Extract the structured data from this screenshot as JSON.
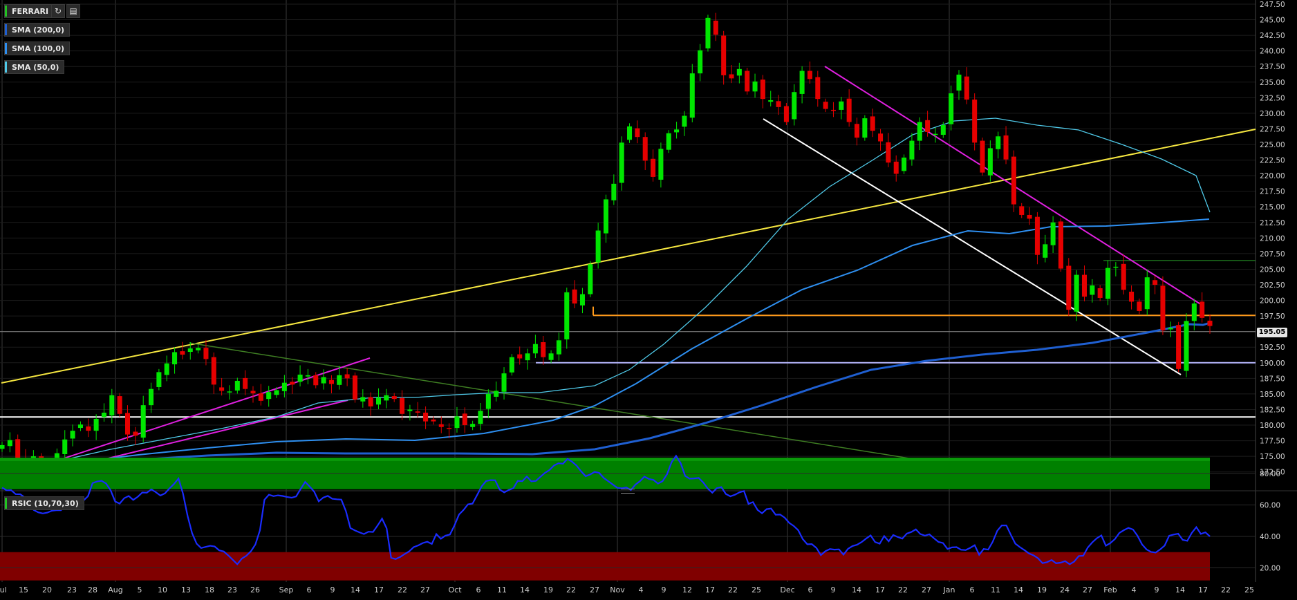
{
  "header": {
    "symbol": "FERRARI",
    "refresh_icon": "refresh-icon",
    "settings_icon": "chart-settings-icon",
    "indicators": [
      {
        "label": "SMA (200,0)",
        "color": "#1f5fd1"
      },
      {
        "label": "SMA (100,0)",
        "color": "#2e8ff0"
      },
      {
        "label": "SMA (50,0)",
        "color": "#4fc9e8"
      }
    ]
  },
  "price_badge": "195.05",
  "rsi_label": "RSIC (10,70,30)",
  "colors": {
    "up": "#00e600",
    "down": "#e60000",
    "sma200": "#1f5fd1",
    "sma100": "#2e8ff0",
    "sma50": "#4fc9e8",
    "rsi": "#1a2cff",
    "overbought": "#008000",
    "oversold": "#800000",
    "yellow": "#f5e640",
    "magenta": "#e020e0",
    "orange": "#ff9a1a",
    "lavender": "#b8b8ff"
  },
  "chart_data": [
    {
      "type": "candlestick",
      "title": "",
      "x_tick_labels": [
        "Jul",
        "15",
        "20",
        "23",
        "28",
        "Aug",
        "5",
        "10",
        "13",
        "18",
        "23",
        "26",
        "Sep",
        "6",
        "9",
        "14",
        "17",
        "22",
        "27",
        "Oct",
        "6",
        "11",
        "14",
        "19",
        "22",
        "27",
        "Nov",
        "4",
        "9",
        "12",
        "17",
        "22",
        "25",
        "Dec",
        "6",
        "9",
        "14",
        "17",
        "22",
        "27",
        "Jan",
        "6",
        "11",
        "14",
        "19",
        "24",
        "27",
        "Feb",
        "4",
        "9",
        "14",
        "17",
        "22",
        "25"
      ],
      "y_ticks": [
        "172.50",
        "175.00",
        "177.50",
        "180.00",
        "182.50",
        "185.00",
        "187.50",
        "190.00",
        "192.50",
        "195.00",
        "197.50",
        "200.00",
        "202.50",
        "205.00",
        "207.50",
        "210.00",
        "212.50",
        "215.00",
        "217.50",
        "220.00",
        "222.50",
        "225.00",
        "227.50",
        "230.00",
        "232.50",
        "235.00",
        "237.50",
        "240.00",
        "242.50",
        "245.00",
        "247.50"
      ],
      "ylim": [
        170.4,
        248.0
      ],
      "last_price": 195.05,
      "closes": [
        176.8,
        177.6,
        174.2,
        173.7,
        175.0,
        173.1,
        173.4,
        175.5,
        177.7,
        179.1,
        180.1,
        179.1,
        181.0,
        182.0,
        184.8,
        181.8,
        178.5,
        178.3,
        183.2,
        185.8,
        188.5,
        189.9,
        191.7,
        191.3,
        192.3,
        192.4,
        190.6,
        186.5,
        185.5,
        185.4,
        187.1,
        185.8,
        185.1,
        183.9,
        185.3,
        185.6,
        186.8,
        186.5,
        188.1,
        188.0,
        186.4,
        187.7,
        186.6,
        188.0,
        187.5,
        184.1,
        184.5,
        183.0,
        184.4,
        184.8,
        184.2,
        181.8,
        182.5,
        182.0,
        180.6,
        180.6,
        179.7,
        179.4,
        181.4,
        180.0,
        180.2,
        182.3,
        185.0,
        185.5,
        188.3,
        190.9,
        190.7,
        191.5,
        193.0,
        190.9,
        191.5,
        193.6,
        201.3,
        199.5,
        201.0,
        205.8,
        211.2,
        216.2,
        218.7,
        225.3,
        227.9,
        226.2,
        222.4,
        219.8,
        224.3,
        226.8,
        227.4,
        229.6,
        236.4,
        240.1,
        245.3,
        242.6,
        236.1,
        235.6,
        237.1,
        233.5,
        235.1,
        232.3,
        232.1,
        231.0,
        228.6,
        233.4,
        236.8,
        235.5,
        232.3,
        230.7,
        230.4,
        231.9,
        228.6,
        226.1,
        229.2,
        227.2,
        225.5,
        222.1,
        220.3,
        222.9,
        225.6,
        228.6,
        227.0,
        226.7,
        228.1,
        233.2,
        236.2,
        232.2,
        225.3,
        220.5,
        224.4,
        226.3,
        222.6,
        215.4,
        213.7,
        213.1,
        207.3,
        209.0,
        212.5,
        205.1,
        198.5,
        204.1,
        200.6,
        202.4,
        200.4,
        205.2,
        205.4,
        201.7,
        199.8,
        198.3,
        203.7,
        202.5,
        195.2,
        195.6,
        189.0,
        196.7,
        199.5,
        197.2,
        195.9
      ]
    },
    {
      "type": "line",
      "title": "",
      "series": [
        {
          "name": "RSIC (10,70,30)"
        }
      ],
      "ylim": [
        2.0,
        100.0
      ],
      "y_ticks": [
        "20.00",
        "40.00",
        "60.00",
        "80.00"
      ],
      "overbought_level": 70,
      "oversold_level": 30,
      "values": [
        71.0,
        69.3,
        69.4,
        66.9,
        66.8,
        64.8,
        61.4,
        56.8,
        55.3,
        54.6,
        55.1,
        56.3,
        56.6,
        56.6,
        59.2,
        60.9,
        63.2,
        63.9,
        62.8,
        65.6,
        73.9,
        74.9,
        75.4,
        73.6,
        69.3,
        62.2,
        60.9,
        64.3,
        65.7,
        63.2,
        65.2,
        67.9,
        67.8,
        69.9,
        68.1,
        66.0,
        67.4,
        70.5,
        73.3,
        76.8,
        67.2,
        53.1,
        42.1,
        35.4,
        32.6,
        33.3,
        34.0,
        33.6,
        31.1,
        30.4,
        27.9,
        25.1,
        22.3,
        25.9,
        27.7,
        30.5,
        34.9,
        43.9,
        63.3,
        66.5,
        65.6,
        66.1,
        65.7,
        65.1,
        64.6,
        65.4,
        70.1,
        74.7,
        71.7,
        68.4,
        62.3,
        64.7,
        65.8,
        63.9,
        63.6,
        63.4,
        56.1,
        45.3,
        43.8,
        42.6,
        41.5,
        43.0,
        42.8,
        46.9,
        51.3,
        45.2,
        26.4,
        25.6,
        26.9,
        28.8,
        30.5,
        33.2,
        34.3,
        35.8,
        36.6,
        35.2,
        41.5,
        38.5,
        40.5,
        41.2,
        46.9,
        53.9,
        56.8,
        60.4,
        60.9,
        66.2,
        71.8,
        75.2,
        75.8,
        75.7,
        69.8,
        68.0,
        69.5,
        70.6,
        75.3,
        75.1,
        78.1,
        75.0,
        75.3,
        77.9,
        80.4,
        82.2,
        85.1,
        86.5,
        86.2,
        89.3,
        87.5,
        85.0,
        81.4,
        78.3,
        79.4,
        81.0,
        80.4,
        77.2,
        75.1,
        73.0,
        70.9,
        70.6,
        71.1,
        69.5,
        72.9,
        75.1,
        78.0,
        76.5,
        75.9,
        73.6,
        75.1,
        79.5,
        87.2,
        91.2,
        86.6,
        78.5,
        76.7,
        76.9,
        77.2,
        74.3,
        70.4,
        67.8,
        70.7,
        71.4,
        67.0,
        65.5,
        66.5,
        68.0,
        68.9,
        60.7,
        61.8,
        56.9,
        54.7,
        57.3,
        57.7,
        53.8,
        53.9,
        51.9,
        48.6,
        46.7,
        43.9,
        38.3,
        35.0,
        35.1,
        32.7,
        28.1,
        30.6,
        32.0,
        31.6,
        31.8,
        28.4,
        32.1,
        33.9,
        34.7,
        36.4,
        38.6,
        40.6,
        36.4,
        35.4,
        40.2,
        36.9,
        40.9,
        39.6,
        38.6,
        41.8,
        42.8,
        44.5,
        41.5,
        40.5,
        41.3,
        38.8,
        36.5,
        35.8,
        32.0,
        33.0,
        33.2,
        31.5,
        31.3,
        32.7,
        34.4,
        28.3,
        32.0,
        31.6,
        36.6,
        43.6,
        47.0,
        47.0,
        41.0,
        35.4,
        33.2,
        31.3,
        29.2,
        28.0,
        26.1,
        23.0,
        23.6,
        25.0,
        22.9,
        23.3,
        24.3,
        22.3,
        24.0,
        27.5,
        27.7,
        32.9,
        36.2,
        38.8,
        40.6,
        34.1,
        35.8,
        38.3,
        42.2,
        44.0,
        45.4,
        44.4,
        40.4,
        34.9,
        31.7,
        30.1,
        29.7,
        31.7,
        34.2,
        40.4,
        41.2,
        41.7,
        37.8,
        37.2,
        42.2,
        45.9,
        41.6,
        42.6,
        40.0
      ]
    }
  ]
}
